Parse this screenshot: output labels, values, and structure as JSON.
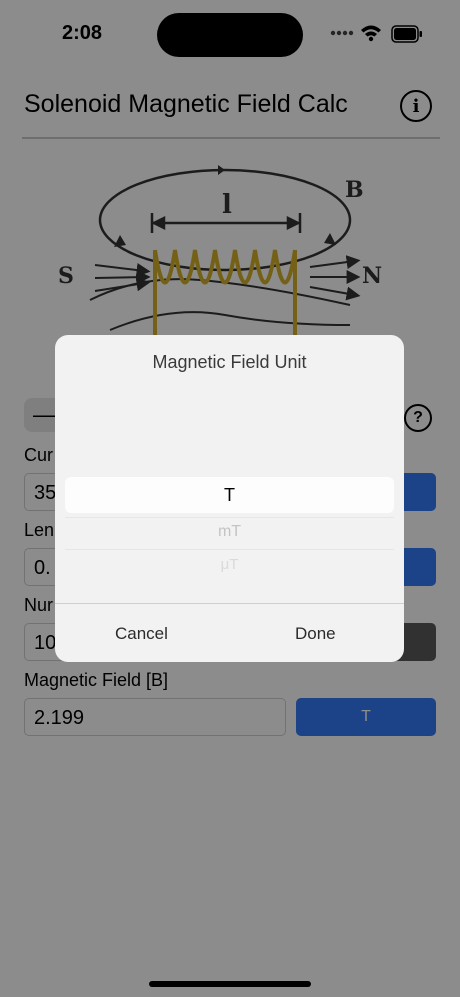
{
  "status_bar": {
    "time": "2:08"
  },
  "header": {
    "title": "Solenoid Magnetic Field Calc",
    "info_icon": "info-circle-icon"
  },
  "diagram": {
    "length_label": "l",
    "field_label": "B",
    "south_label": "S",
    "north_label": "N"
  },
  "segment": {
    "label": "—"
  },
  "help_icon": "question-circle-icon",
  "fields": [
    {
      "label": "Cur",
      "value": "35",
      "unit": "",
      "unit_color": "#3478f6"
    },
    {
      "label": "Len",
      "value": "0.",
      "unit": "",
      "unit_color": "#3478f6"
    },
    {
      "label": "Nur",
      "value": "10",
      "unit": "",
      "unit_color": "#5a5a5a"
    },
    {
      "label": "Magnetic Field [B]",
      "value": "2.199",
      "unit": "T",
      "unit_color": "#3478f6"
    }
  ],
  "picker": {
    "title": "Magnetic Field Unit",
    "options": [
      "T",
      "mT",
      "μT"
    ],
    "selected": "T",
    "cancel_label": "Cancel",
    "done_label": "Done"
  }
}
